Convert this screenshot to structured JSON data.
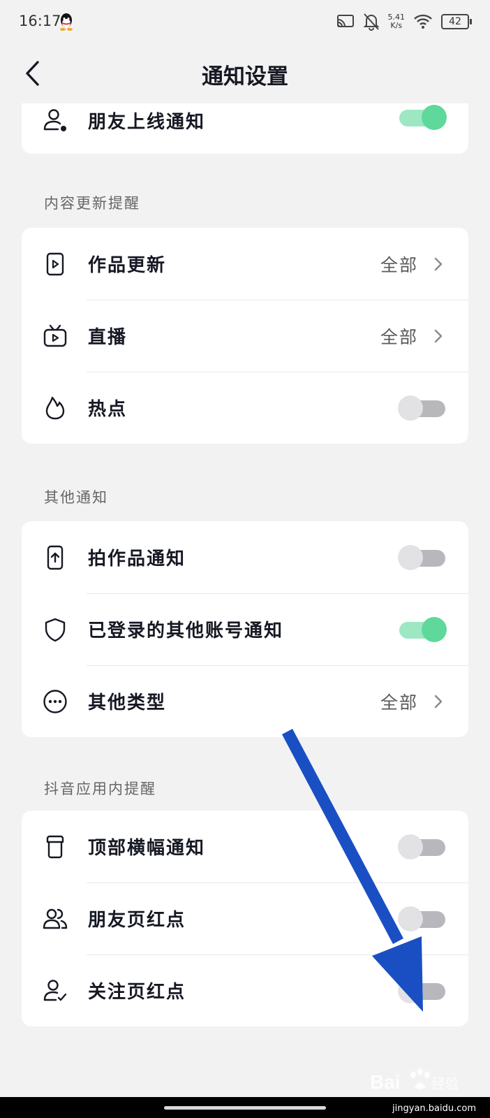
{
  "status_bar": {
    "time": "16:17",
    "speed_value": "5.41",
    "speed_unit": "K/s",
    "battery": "42"
  },
  "header": {
    "title": "通知设置"
  },
  "cards": [
    {
      "rows": [
        {
          "label": "朋友上线通知",
          "icon": "person-dot-icon",
          "control": "toggle",
          "on": true
        }
      ]
    },
    {
      "section": "内容更新提醒",
      "rows": [
        {
          "label": "作品更新",
          "icon": "video-play-icon",
          "control": "value",
          "value": "全部"
        },
        {
          "label": "直播",
          "icon": "tv-icon",
          "control": "value",
          "value": "全部"
        },
        {
          "label": "热点",
          "icon": "flame-icon",
          "control": "toggle",
          "on": false
        }
      ]
    },
    {
      "section": "其他通知",
      "rows": [
        {
          "label": "拍作品通知",
          "icon": "phone-upload-icon",
          "control": "toggle",
          "on": false
        },
        {
          "label": "已登录的其他账号通知",
          "icon": "shield-icon",
          "control": "toggle",
          "on": true
        },
        {
          "label": "其他类型",
          "icon": "more-circle-icon",
          "control": "value",
          "value": "全部"
        }
      ]
    },
    {
      "section": "抖音应用内提醒",
      "rows": [
        {
          "label": "顶部横幅通知",
          "icon": "banner-icon",
          "control": "toggle",
          "on": false
        },
        {
          "label": "朋友页红点",
          "icon": "friends-icon",
          "control": "toggle",
          "on": false
        },
        {
          "label": "关注页红点",
          "icon": "person-check-icon",
          "control": "toggle",
          "on": false
        }
      ]
    }
  ],
  "annotation": {
    "color": "#1a4fc4"
  },
  "watermark": {
    "brand": "Baidu经验",
    "url": "jingyan.baidu.com"
  }
}
